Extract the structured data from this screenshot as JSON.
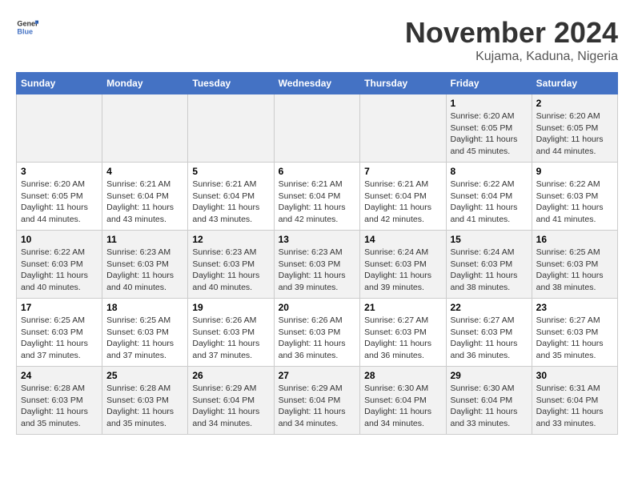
{
  "header": {
    "logo_general": "General",
    "logo_blue": "Blue",
    "month_title": "November 2024",
    "location": "Kujama, Kaduna, Nigeria"
  },
  "weekdays": [
    "Sunday",
    "Monday",
    "Tuesday",
    "Wednesday",
    "Thursday",
    "Friday",
    "Saturday"
  ],
  "weeks": [
    [
      {
        "day": "",
        "info": ""
      },
      {
        "day": "",
        "info": ""
      },
      {
        "day": "",
        "info": ""
      },
      {
        "day": "",
        "info": ""
      },
      {
        "day": "",
        "info": ""
      },
      {
        "day": "1",
        "info": "Sunrise: 6:20 AM\nSunset: 6:05 PM\nDaylight: 11 hours and 45 minutes."
      },
      {
        "day": "2",
        "info": "Sunrise: 6:20 AM\nSunset: 6:05 PM\nDaylight: 11 hours and 44 minutes."
      }
    ],
    [
      {
        "day": "3",
        "info": "Sunrise: 6:20 AM\nSunset: 6:05 PM\nDaylight: 11 hours and 44 minutes."
      },
      {
        "day": "4",
        "info": "Sunrise: 6:21 AM\nSunset: 6:04 PM\nDaylight: 11 hours and 43 minutes."
      },
      {
        "day": "5",
        "info": "Sunrise: 6:21 AM\nSunset: 6:04 PM\nDaylight: 11 hours and 43 minutes."
      },
      {
        "day": "6",
        "info": "Sunrise: 6:21 AM\nSunset: 6:04 PM\nDaylight: 11 hours and 42 minutes."
      },
      {
        "day": "7",
        "info": "Sunrise: 6:21 AM\nSunset: 6:04 PM\nDaylight: 11 hours and 42 minutes."
      },
      {
        "day": "8",
        "info": "Sunrise: 6:22 AM\nSunset: 6:04 PM\nDaylight: 11 hours and 41 minutes."
      },
      {
        "day": "9",
        "info": "Sunrise: 6:22 AM\nSunset: 6:03 PM\nDaylight: 11 hours and 41 minutes."
      }
    ],
    [
      {
        "day": "10",
        "info": "Sunrise: 6:22 AM\nSunset: 6:03 PM\nDaylight: 11 hours and 40 minutes."
      },
      {
        "day": "11",
        "info": "Sunrise: 6:23 AM\nSunset: 6:03 PM\nDaylight: 11 hours and 40 minutes."
      },
      {
        "day": "12",
        "info": "Sunrise: 6:23 AM\nSunset: 6:03 PM\nDaylight: 11 hours and 40 minutes."
      },
      {
        "day": "13",
        "info": "Sunrise: 6:23 AM\nSunset: 6:03 PM\nDaylight: 11 hours and 39 minutes."
      },
      {
        "day": "14",
        "info": "Sunrise: 6:24 AM\nSunset: 6:03 PM\nDaylight: 11 hours and 39 minutes."
      },
      {
        "day": "15",
        "info": "Sunrise: 6:24 AM\nSunset: 6:03 PM\nDaylight: 11 hours and 38 minutes."
      },
      {
        "day": "16",
        "info": "Sunrise: 6:25 AM\nSunset: 6:03 PM\nDaylight: 11 hours and 38 minutes."
      }
    ],
    [
      {
        "day": "17",
        "info": "Sunrise: 6:25 AM\nSunset: 6:03 PM\nDaylight: 11 hours and 37 minutes."
      },
      {
        "day": "18",
        "info": "Sunrise: 6:25 AM\nSunset: 6:03 PM\nDaylight: 11 hours and 37 minutes."
      },
      {
        "day": "19",
        "info": "Sunrise: 6:26 AM\nSunset: 6:03 PM\nDaylight: 11 hours and 37 minutes."
      },
      {
        "day": "20",
        "info": "Sunrise: 6:26 AM\nSunset: 6:03 PM\nDaylight: 11 hours and 36 minutes."
      },
      {
        "day": "21",
        "info": "Sunrise: 6:27 AM\nSunset: 6:03 PM\nDaylight: 11 hours and 36 minutes."
      },
      {
        "day": "22",
        "info": "Sunrise: 6:27 AM\nSunset: 6:03 PM\nDaylight: 11 hours and 36 minutes."
      },
      {
        "day": "23",
        "info": "Sunrise: 6:27 AM\nSunset: 6:03 PM\nDaylight: 11 hours and 35 minutes."
      }
    ],
    [
      {
        "day": "24",
        "info": "Sunrise: 6:28 AM\nSunset: 6:03 PM\nDaylight: 11 hours and 35 minutes."
      },
      {
        "day": "25",
        "info": "Sunrise: 6:28 AM\nSunset: 6:03 PM\nDaylight: 11 hours and 35 minutes."
      },
      {
        "day": "26",
        "info": "Sunrise: 6:29 AM\nSunset: 6:04 PM\nDaylight: 11 hours and 34 minutes."
      },
      {
        "day": "27",
        "info": "Sunrise: 6:29 AM\nSunset: 6:04 PM\nDaylight: 11 hours and 34 minutes."
      },
      {
        "day": "28",
        "info": "Sunrise: 6:30 AM\nSunset: 6:04 PM\nDaylight: 11 hours and 34 minutes."
      },
      {
        "day": "29",
        "info": "Sunrise: 6:30 AM\nSunset: 6:04 PM\nDaylight: 11 hours and 33 minutes."
      },
      {
        "day": "30",
        "info": "Sunrise: 6:31 AM\nSunset: 6:04 PM\nDaylight: 11 hours and 33 minutes."
      }
    ]
  ]
}
